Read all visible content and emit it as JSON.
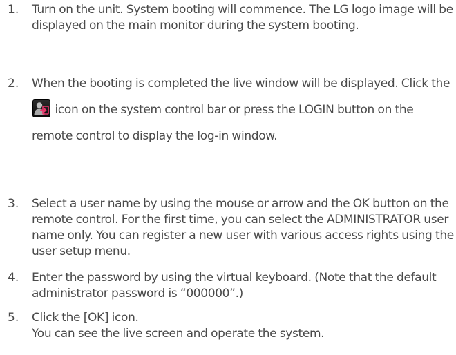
{
  "steps": [
    {
      "number": "1.",
      "text": "Turn on the unit. System booting will commence. The LG logo image will be displayed on the main monitor during the system booting."
    },
    {
      "number": "2.",
      "text_before_icon": "When the booting is completed the live window will be displayed. Click the ",
      "icon": "login-icon",
      "text_after_icon": " icon on the system control bar or press the LOGIN button on the remote control to display the log-in window."
    },
    {
      "number": "3.",
      "text": "Select a user name by using the mouse or arrow and the OK button on the remote control. For the first time, you can select the ADMINISTRATOR user name only. You can register a new user with various access rights using the user setup menu."
    },
    {
      "number": "4.",
      "text": "Enter the password by using the virtual keyboard. (Note that the default administrator password is “000000”.)"
    },
    {
      "number": "5.",
      "line1": "Click the [OK] icon.",
      "line2": "You can see the live screen and operate the system."
    }
  ],
  "colors": {
    "text": "#4a4a4a",
    "icon_accent": "#e8356a",
    "icon_person": "#b5b5b5"
  }
}
